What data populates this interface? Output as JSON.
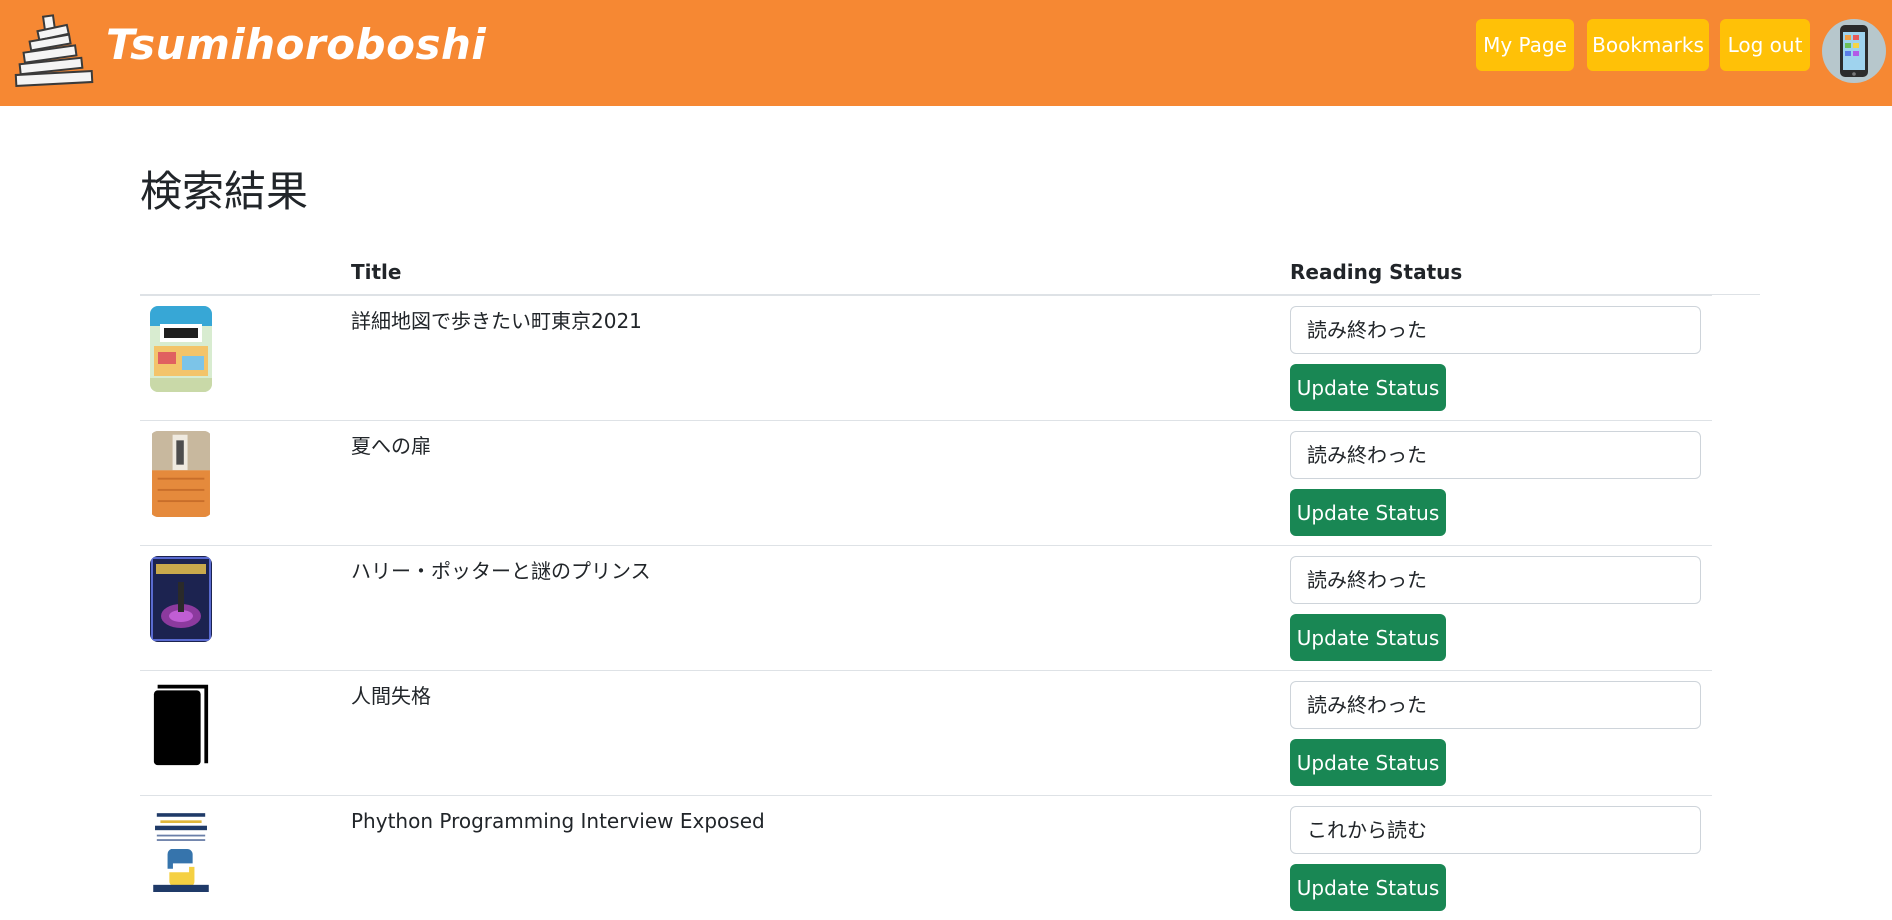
{
  "header": {
    "brand": "Tsumihoroboshi",
    "nav": {
      "my_page": "My Page",
      "bookmarks": "Bookmarks",
      "log_out": "Log out"
    },
    "colors": {
      "bar": "#f68833",
      "nav_button": "#ffc107"
    },
    "icons": {
      "logo": "stacked-books-logo-icon",
      "avatar": "smartphone-avatar-icon"
    }
  },
  "main": {
    "title": "検索結果",
    "columns": {
      "cover": "",
      "title": "Title",
      "status": "Reading Status"
    },
    "books": [
      {
        "title": "詳細地図で歩きたい町東京2021",
        "status": "読み終わった",
        "button": "Update Status",
        "cover": "tokyo-map-guide-cover"
      },
      {
        "title": "夏への扉",
        "status": "読み終わった",
        "button": "Update Status",
        "cover": "door-into-summer-cover"
      },
      {
        "title": "ハリー・ポッターと謎のプリンス",
        "status": "読み終わった",
        "button": "Update Status",
        "cover": "harry-potter-cover"
      },
      {
        "title": "人間失格",
        "status": "読み終わった",
        "button": "Update Status",
        "cover": "placeholder-book-icon"
      },
      {
        "title": "Phython Programming Interview Exposed",
        "status": "これから読む",
        "button": "Update Status",
        "cover": "python-book-cover"
      }
    ],
    "colors": {
      "update_button": "#198754"
    }
  }
}
